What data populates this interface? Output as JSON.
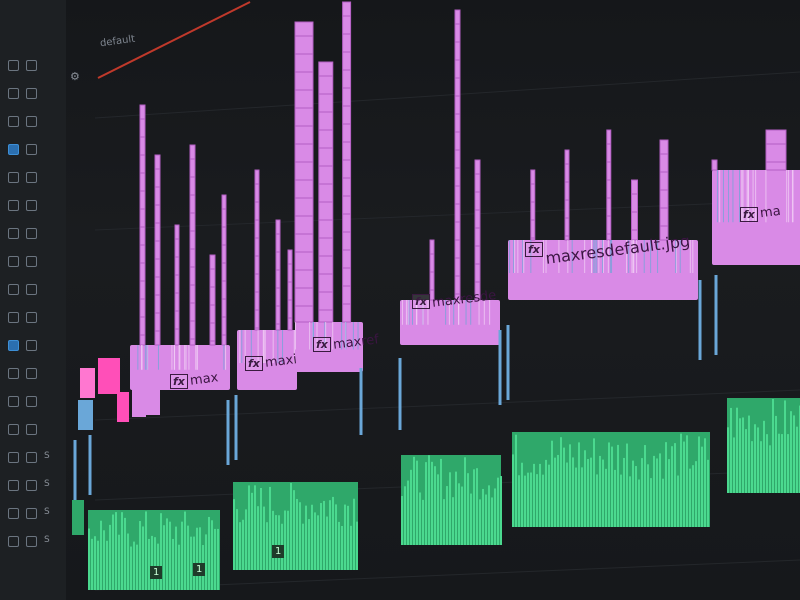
{
  "app": {
    "sequence_label": "default",
    "colors": {
      "video_clip": "#d98ae6",
      "video_clip_dark": "#b45fc4",
      "audio_clip": "#4bd98f",
      "audio_clip_dark": "#2fa86a",
      "playhead": "#c0392b",
      "accent_blue": "#6aa7d8",
      "background": "#16181b"
    },
    "track_header": {
      "audio_solo_letter": "S",
      "audio_track_icon": "speaker-icon",
      "video_track_icon": "eye-icon"
    }
  },
  "timeline": {
    "video_clips": [
      {
        "name": "max",
        "fx": "fx"
      },
      {
        "name": "maxi",
        "fx": "fx"
      },
      {
        "name": "maxref",
        "fx": "fx"
      },
      {
        "name": "maxresde",
        "fx": "fx"
      },
      {
        "name": "maxresdefault.jpg",
        "fx": "fx"
      },
      {
        "name": "ma",
        "fx": "fx"
      }
    ],
    "audio_badges": [
      "1",
      "1",
      "1"
    ]
  }
}
